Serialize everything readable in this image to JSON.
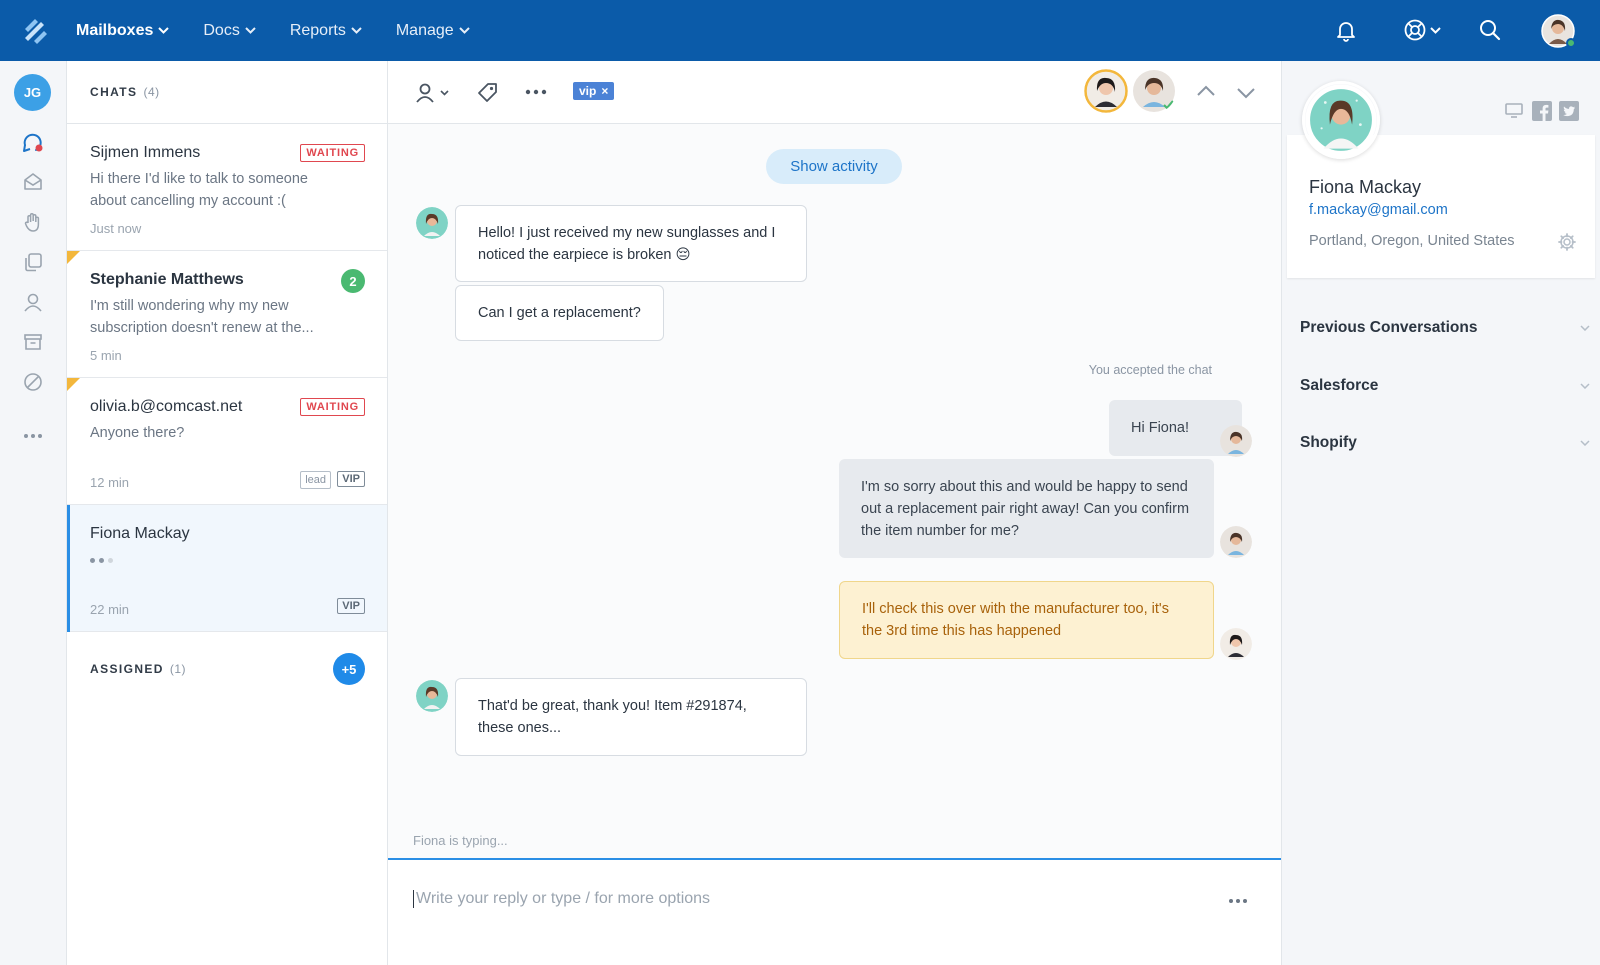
{
  "nav": {
    "items": [
      {
        "label": "Mailboxes",
        "active": true
      },
      {
        "label": "Docs",
        "active": false
      },
      {
        "label": "Reports",
        "active": false
      },
      {
        "label": "Manage",
        "active": false
      }
    ]
  },
  "rail": {
    "user_initials": "JG",
    "icons": [
      "chat-icon",
      "inbox-icon",
      "hand-icon",
      "docs-icon",
      "user-icon",
      "archive-icon",
      "block-icon",
      "more-icon"
    ]
  },
  "chats": {
    "header": "CHATS",
    "count": "(4)",
    "items": [
      {
        "name": "Sijmen Immens",
        "preview": "Hi there I'd like to talk to someone about cancelling my account :(",
        "time": "Just now",
        "badge": "WAITING"
      },
      {
        "name": "Stephanie Matthews",
        "preview": "I'm still wondering why my new subscription doesn't renew at the...",
        "time": "5 min",
        "unread": "2"
      },
      {
        "name": "olivia.b@comcast.net",
        "preview": "Anyone there?",
        "time": "12 min",
        "badge": "WAITING",
        "tag_lead": "lead",
        "tag_vip": "VIP"
      },
      {
        "name": "Fiona Mackay",
        "time": "22 min",
        "tag_vip": "VIP"
      }
    ],
    "assigned_label": "ASSIGNED",
    "assigned_count": "(1)",
    "assigned_more": "+5"
  },
  "conversation": {
    "tag_label": "vip",
    "tag_remove": "×",
    "show_activity": "Show activity",
    "messages": [
      {
        "from": "customer",
        "text": "Hello! I just received my new sunglasses and I noticed the earpiece is broken 😔"
      },
      {
        "from": "customer",
        "text": "Can I get a replacement?"
      },
      {
        "from": "agent",
        "text": "Hi Fiona!"
      },
      {
        "from": "agent",
        "text": "I'm so sorry about this and would be happy to send out a replacement pair right away! Can you confirm the item number for me?"
      },
      {
        "from": "note",
        "text": "I'll check this over with the manufacturer too, it's the 3rd time this has happened"
      },
      {
        "from": "customer",
        "text": "That'd be great, thank you! Item #291874, these ones..."
      }
    ],
    "accepted_note": "You accepted the chat",
    "typing_status": "Fiona is typing...",
    "composer_placeholder": "Write your reply or type / for more options"
  },
  "customer": {
    "name": "Fiona Mackay",
    "email": "f.mackay@gmail.com",
    "location": "Portland, Oregon, United States"
  },
  "sections": [
    {
      "label": "Previous Conversations"
    },
    {
      "label": "Salesforce"
    },
    {
      "label": "Shopify"
    }
  ],
  "colors": {
    "topbar": "#0b5ba9",
    "accent": "#2a8ee5",
    "waiting": "#e0474f",
    "unread": "#4ab971",
    "note_bg": "#fdf1d2"
  }
}
